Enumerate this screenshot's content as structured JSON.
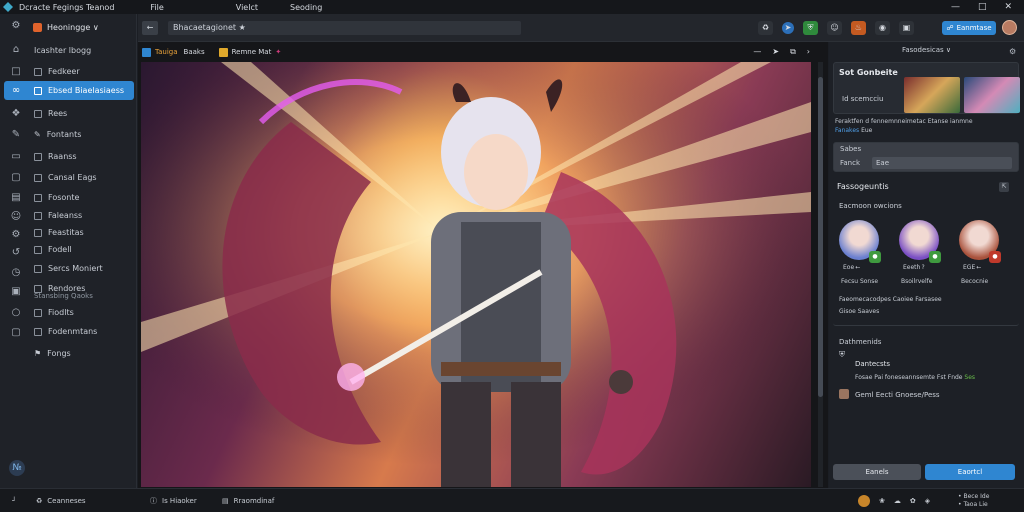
{
  "window": {
    "title": "Dcracte Fegings Teanod",
    "menu": [
      "File",
      "Vielct",
      "Seoding"
    ],
    "controls": [
      "minimize-icon",
      "maximize-icon",
      "close-icon"
    ]
  },
  "sidebar": {
    "brand": "Heoningge ∨",
    "section_label": "Icashter lbogg",
    "items": [
      {
        "label": "Fedkeer",
        "icon": "layers-icon",
        "active": false
      },
      {
        "label": "Ebsed Biaelasiaess",
        "icon": "link-icon",
        "active": true
      },
      {
        "label": "Rees",
        "icon": "bookmark-icon",
        "active": false
      },
      {
        "label": "Fontants",
        "icon": "pen-icon",
        "active": false
      },
      {
        "label": "Raanss",
        "icon": "card-icon",
        "active": false
      },
      {
        "label": "Cansal Eags",
        "icon": "box-icon",
        "active": false
      },
      {
        "label": "Fosonte",
        "icon": "book-icon",
        "active": false
      },
      {
        "label": "Faleanss",
        "icon": "person-icon",
        "active": false
      },
      {
        "label": "Feastitas",
        "icon": "gear-icon",
        "active": false
      },
      {
        "label": "Fodell",
        "icon": "pin-icon",
        "active": false
      },
      {
        "label": "Sercs Moniert",
        "icon": "clock-icon",
        "active": false
      },
      {
        "label": "Rendores",
        "icon": "monitor-icon",
        "active": false
      }
    ],
    "sub_label": "Stansbing Qaoks",
    "items2": [
      {
        "label": "Fiodlts",
        "icon": "bell-icon"
      },
      {
        "label": "Fodenmtans",
        "icon": "chat-icon"
      },
      {
        "label": "Fongs",
        "icon": "flag-icon"
      }
    ]
  },
  "toolbar": {
    "url": "Bhacaetagionet ★",
    "share_label": "Eanmtase",
    "icons": [
      "extension-icon",
      "telegram-icon",
      "shield-icon",
      "smile-icon",
      "fire-icon",
      "globe-icon",
      "image-icon"
    ]
  },
  "canvas": {
    "tab_label": "Tauiga",
    "tab_label2": "Baaks",
    "tab_label3": "Remne Mat",
    "header_icons": [
      "pin-icon",
      "send-icon",
      "copy-icon",
      "chevron-right-icon"
    ]
  },
  "right_panel": {
    "title": "Fasodesicas ∨",
    "card1": {
      "title": "Sot Gonbeite",
      "subtitle": "Id scemcciu",
      "desc": "Feraktfen d fennemnneimetac Etanse ianmne",
      "link": "Fanakes",
      "link_suffix": "Eue"
    },
    "card2": {
      "title": "Sabes",
      "field_label": "Fanck",
      "field_value": "Eae"
    },
    "section": {
      "title": "Fassogeuntis",
      "subtitle": "Eacmoon owcions",
      "avatars": [
        {
          "label": "Eoe ←",
          "caption": "Fecsu Sonse",
          "color": "#6a7fd0"
        },
        {
          "label": "Eeeth ?",
          "caption": "Bsoilrvelfe",
          "color": "#7a4fc4"
        },
        {
          "label": "EGE ←",
          "caption": "Becocnie",
          "color": "#a9523c"
        }
      ],
      "footer_text": "Faeomecacodpes Caoiee Farsasee",
      "footer_link": "Gisoe Saaves"
    },
    "section2": {
      "title": "Dathmenids",
      "item1": "Dantecsts",
      "item1_sub": "Fosae Pai foneseannsemte Fst Fnde",
      "item1_tag": "Ses",
      "item2": "Geml Eecti Gnoese/Pess"
    },
    "buttons": {
      "cancel": "Eanels",
      "confirm": "Eaortcl"
    }
  },
  "statusbar": {
    "left": "Ceanneses",
    "center1": "Is Hiaoker",
    "center2": "Rraomdinaf",
    "right": "• Bece Ide\n• Taoa Lie"
  }
}
